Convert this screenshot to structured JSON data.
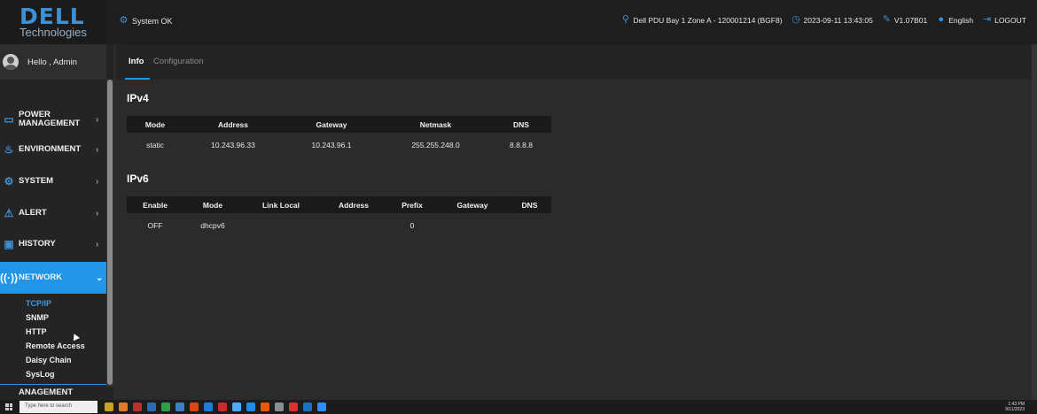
{
  "header": {
    "brand_main": "DELL",
    "brand_sub": "Technologies",
    "system_status": "System OK",
    "location": "Dell PDU Bay 1 Zone A - 120001214 (BGF8)",
    "datetime": "2023-09-11 13:43:05",
    "version": "V1.07B01",
    "language": "English",
    "logout": "LOGOUT"
  },
  "sidebar": {
    "greeting": "Hello , Admin",
    "items": [
      {
        "label": "POWER MANAGEMENT",
        "icon": "power-management-icon"
      },
      {
        "label": "ENVIRONMENT",
        "icon": "environment-icon"
      },
      {
        "label": "SYSTEM",
        "icon": "gear-icon"
      },
      {
        "label": "ALERT",
        "icon": "alert-icon"
      },
      {
        "label": "HISTORY",
        "icon": "history-icon"
      },
      {
        "label": "NETWORK",
        "icon": "network-icon"
      }
    ],
    "network_subitems": [
      "TCP/IP",
      "SNMP",
      "HTTP",
      "Remote Access",
      "Daisy Chain",
      "SysLog"
    ],
    "partial_next": "ANAGEMENT",
    "active_subitem": "TCP/IP"
  },
  "tabs": {
    "info": "Info",
    "configuration": "Configuration"
  },
  "ipv4": {
    "title": "IPv4",
    "headers": [
      "Mode",
      "Address",
      "Gateway",
      "Netmask",
      "DNS"
    ],
    "row": [
      "static",
      "10.243.96.33",
      "10.243.96.1",
      "255.255.248.0",
      "8.8.8.8"
    ]
  },
  "ipv6": {
    "title": "IPv6",
    "headers": [
      "Enable",
      "Mode",
      "Link Local",
      "Address",
      "Prefix",
      "Gateway",
      "DNS"
    ],
    "row": [
      "OFF",
      "dhcpv6",
      "",
      "",
      "0",
      "",
      ""
    ]
  },
  "taskbar": {
    "search_placeholder": "Type here to search",
    "time": "1:43 PM",
    "date": "9/11/2023"
  },
  "colors": {
    "accent": "#2196e8",
    "background": "#2b2b2b",
    "topbar": "#1e1e1e"
  }
}
